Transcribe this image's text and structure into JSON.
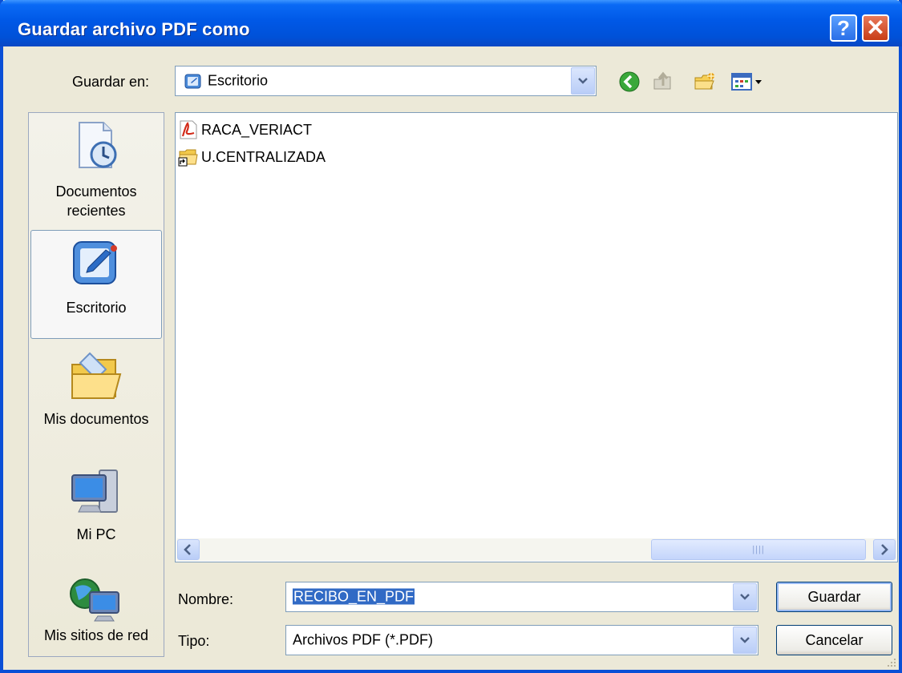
{
  "window": {
    "title": "Guardar archivo PDF como"
  },
  "title_buttons": {
    "help": "?",
    "close": "✕"
  },
  "save_in": {
    "label": "Guardar en:",
    "value": "Escritorio"
  },
  "toolbar": {
    "icons": [
      "back-icon",
      "up-folder-icon",
      "new-folder-icon",
      "view-menu-icon"
    ]
  },
  "places": [
    {
      "label": "Documentos recientes",
      "icon": "recent-documents-icon"
    },
    {
      "label": "Escritorio",
      "icon": "desktop-icon"
    },
    {
      "label": "Mis documentos",
      "icon": "my-documents-icon"
    },
    {
      "label": "Mi PC",
      "icon": "my-computer-icon"
    },
    {
      "label": "Mis sitios de red",
      "icon": "network-places-icon"
    }
  ],
  "files": [
    {
      "name": "RACA_VERIACT",
      "icon": "pdf-file-icon"
    },
    {
      "name": "U.CENTRALIZADA",
      "icon": "folder-shortcut-icon"
    }
  ],
  "filename": {
    "label": "Nombre:",
    "value": "RECIBO_EN_PDF"
  },
  "filetype": {
    "label": "Tipo:",
    "value": "Archivos PDF (*.PDF)"
  },
  "buttons": {
    "save": "Guardar",
    "cancel": "Cancelar"
  },
  "colors": {
    "title_bar": "#0058e6",
    "selection": "#316ac5",
    "dialog_bg": "#ece9d8"
  }
}
